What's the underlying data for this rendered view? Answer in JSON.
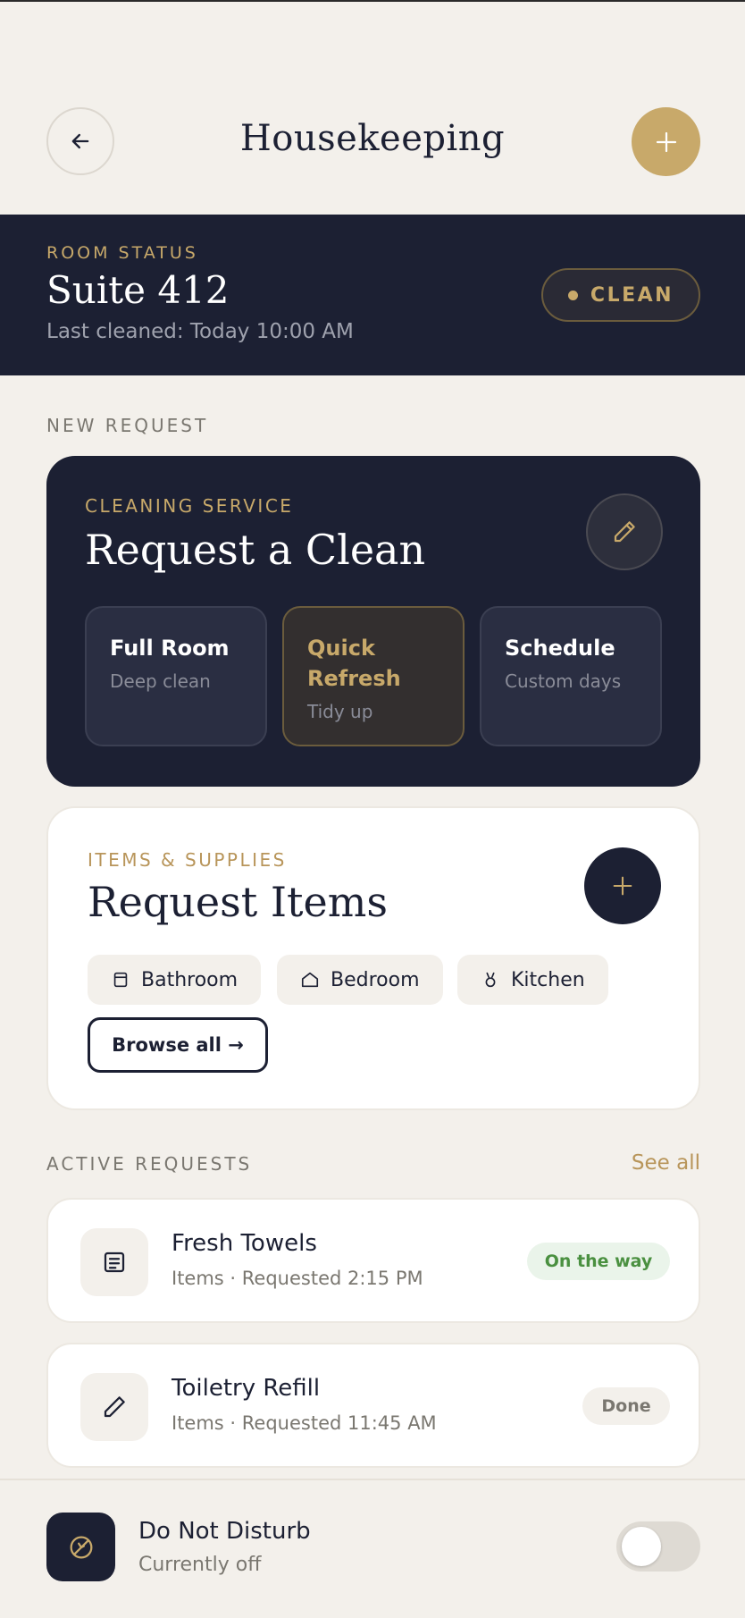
{
  "header": {
    "title": "Housekeeping",
    "back_icon": "arrow-left-icon",
    "add_icon": "plus-icon"
  },
  "room_status": {
    "label": "ROOM STATUS",
    "room": "Suite 412",
    "last_cleaned": "Last cleaned: Today 10:00 AM",
    "status": "CLEAN"
  },
  "new_request": {
    "section_label": "NEW REQUEST",
    "clean": {
      "eyebrow": "CLEANING SERVICE",
      "title": "Request a Clean",
      "options": [
        {
          "title": "Full Room",
          "subtitle": "Deep clean",
          "selected": false
        },
        {
          "title": "Quick Refresh",
          "subtitle": "Tidy up",
          "selected": true
        },
        {
          "title": "Schedule",
          "subtitle": "Custom days",
          "selected": false
        }
      ]
    },
    "items": {
      "eyebrow": "ITEMS & SUPPLIES",
      "title": "Request Items",
      "chips": [
        {
          "label": "Bathroom",
          "icon": "bathroom-icon"
        },
        {
          "label": "Bedroom",
          "icon": "bedroom-icon"
        },
        {
          "label": "Kitchen",
          "icon": "kitchen-icon"
        }
      ],
      "browse_label": "Browse all →"
    }
  },
  "active_requests": {
    "section_label": "ACTIVE REQUESTS",
    "see_all": "See all",
    "rows": [
      {
        "title": "Fresh Towels",
        "subtitle": "Items · Requested 2:15 PM",
        "status": "On the way",
        "icon": "document-icon"
      },
      {
        "title": "Toiletry Refill",
        "subtitle": "Items · Requested 11:45 AM",
        "status": "Done",
        "icon": "pencil-icon"
      }
    ]
  },
  "dnd": {
    "title": "Do Not Disturb",
    "subtitle": "Currently off",
    "enabled": false
  },
  "colors": {
    "navy": "#1C2033",
    "gold": "#C8A96A",
    "background": "#F3F0EB",
    "success": "#4A9040"
  }
}
